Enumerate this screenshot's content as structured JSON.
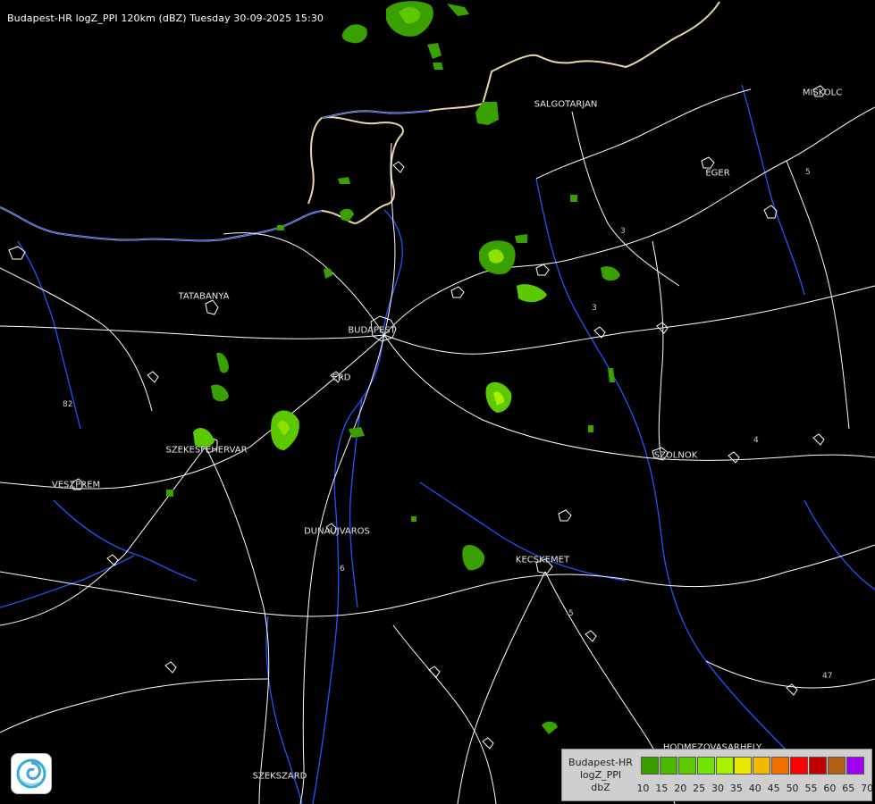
{
  "title": "Budapest-HR logZ_PPI 120km (dBZ) Tuesday 30-09-2025 15:30",
  "cities": [
    {
      "name": "SALGÓTARJÁN",
      "label": "SALGOTARJAN"
    },
    {
      "name": "EGER",
      "label": "EGER"
    },
    {
      "name": "TATABÁNYA",
      "label": "TATABANYA"
    },
    {
      "name": "BUDAPEST",
      "label": "BUDAPEST"
    },
    {
      "name": "ÉRD",
      "label": "ERD"
    },
    {
      "name": "SZÉKESFEHÉRVÁR",
      "label": "SZEKESFEHERVAR"
    },
    {
      "name": "VESZPRÉM",
      "label": "VESZPREM"
    },
    {
      "name": "DUNAÚJVÁROS",
      "label": "DUNAUJVAROS"
    },
    {
      "name": "SZOLNOK",
      "label": "SZOLNOK"
    },
    {
      "name": "KECSKEMÉT",
      "label": "KECSKEMET"
    },
    {
      "name": "HÓDMEZŐVÁSÁRHELY",
      "label": "HODMEZOVASARHELY"
    },
    {
      "name": "SZEKSZÁRD",
      "label": "SZEKSZARD"
    },
    {
      "name": "MISKOLC",
      "label": "MISKOLC"
    }
  ],
  "road_numbers": [
    "3",
    "3",
    "4",
    "5",
    "82",
    "6",
    "5",
    "47"
  ],
  "legend": {
    "line1": "Budapest-HR",
    "line2": "logZ_PPI",
    "line3": "dbZ",
    "levels": [
      "10",
      "15",
      "20",
      "25",
      "30",
      "35",
      "40",
      "45",
      "50",
      "55",
      "60",
      "65",
      "70"
    ],
    "colors": [
      "#3a9d00",
      "#4cb800",
      "#5ccc00",
      "#6ee600",
      "#a8f000",
      "#e8e800",
      "#f5b800",
      "#f07000",
      "#ff0000",
      "#c00000",
      "#b06010",
      "#a000f0",
      "#b8b8ff"
    ]
  },
  "colors": {
    "border": "#e8d6a8",
    "road": "#ffffff",
    "river": "#2255ff",
    "echo_weak": "#3aa000",
    "echo_mid": "#5cc800",
    "echo_strong": "#8ee000"
  }
}
